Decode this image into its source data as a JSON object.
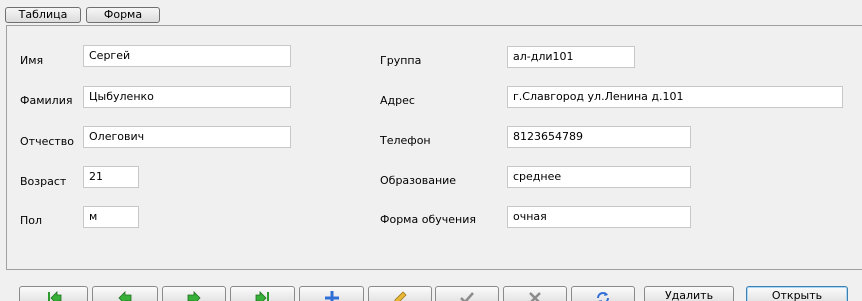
{
  "tabs": {
    "table_label": "Таблица",
    "form_label": "Форма"
  },
  "left_fields": {
    "name": {
      "label": "Имя",
      "value": "Сергей"
    },
    "surname": {
      "label": "Фамилия",
      "value": "Цыбуленко"
    },
    "patronymic": {
      "label": "Отчество",
      "value": "Олегович"
    },
    "age": {
      "label": "Возраст",
      "value": "21"
    },
    "gender": {
      "label": "Пол",
      "value": "м"
    }
  },
  "right_fields": {
    "group": {
      "label": "Группа",
      "value": "ал-дли101"
    },
    "address": {
      "label": "Адрес",
      "value": "г.Славгород ул.Ленина д.101"
    },
    "phone": {
      "label": "Телефон",
      "value": "8123654789"
    },
    "education": {
      "label": "Образование",
      "value": "среднее"
    },
    "study_form": {
      "label": "Форма обучения",
      "value": "очная"
    }
  },
  "toolbar": {
    "icons": {
      "first": "first-record-icon",
      "prev": "previous-record-icon",
      "next": "next-record-icon",
      "last": "last-record-icon",
      "add": "add-record-icon",
      "edit": "edit-record-icon",
      "save": "checkmark-icon",
      "cancel": "cancel-icon",
      "refresh": "refresh-icon"
    },
    "delete_label": "Удалить",
    "open_label": "Открыть"
  },
  "colors": {
    "nav_arrow": "#2e9b2e",
    "add_plus": "#2f6fd6",
    "edit_pencil": "#e8b838",
    "disabled": "#8c8c8c",
    "refresh": "#2f6fd6"
  }
}
